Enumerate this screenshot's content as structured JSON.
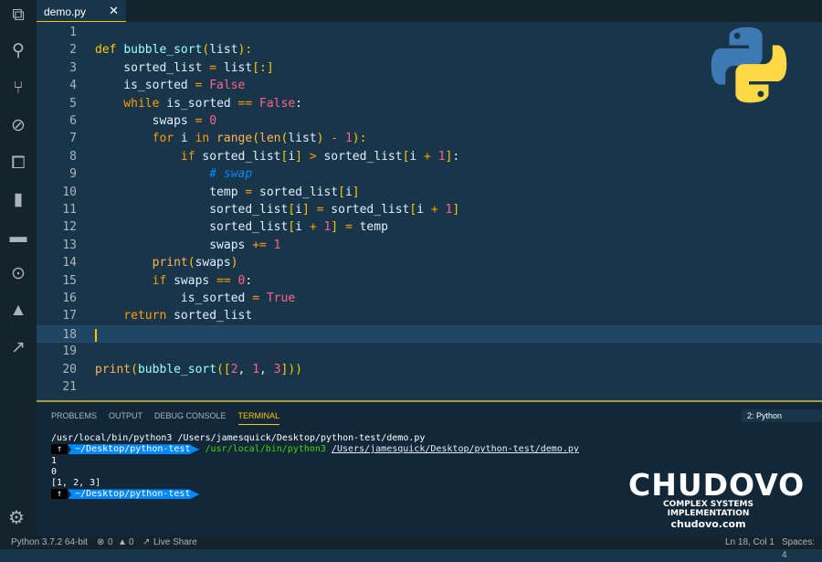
{
  "tab": {
    "label": "demo.py",
    "close": "✕"
  },
  "activity_icons": [
    "files-icon",
    "search-icon",
    "source-control-icon",
    "debug-icon",
    "extensions-icon",
    "bookmark-icon",
    "folder-icon",
    "git-lens-icon",
    "firebase-icon",
    "live-share-icon"
  ],
  "colors": {
    "editor_bg": "#193549",
    "keyword": "#ffc600",
    "string_bool": "#ff628c",
    "operator": "#ff9d00",
    "comment": "#0088ff"
  },
  "code_lines": [
    [],
    [
      [
        "kw",
        "def "
      ],
      [
        "fn",
        "bubble_sort"
      ],
      [
        "pu",
        "("
      ],
      [
        "id",
        "list"
      ],
      [
        "pu",
        "):"
      ]
    ],
    [
      [
        "id",
        "    sorted_list "
      ],
      [
        "op",
        "="
      ],
      [
        "id",
        " list"
      ],
      [
        "pu",
        "[:]"
      ]
    ],
    [
      [
        "id",
        "    is_sorted "
      ],
      [
        "op",
        "="
      ],
      [
        "bo",
        " False"
      ]
    ],
    [
      [
        "kw2",
        "    while"
      ],
      [
        "id",
        " is_sorted "
      ],
      [
        "op",
        "=="
      ],
      [
        "bo",
        " False"
      ],
      [
        "id",
        ":"
      ]
    ],
    [
      [
        "id",
        "        swaps "
      ],
      [
        "op",
        "="
      ],
      [
        "nu",
        " 0"
      ]
    ],
    [
      [
        "kw2",
        "        for"
      ],
      [
        "id",
        " i "
      ],
      [
        "kw2",
        "in"
      ],
      [
        "bi",
        " range"
      ],
      [
        "pu",
        "("
      ],
      [
        "bi",
        "len"
      ],
      [
        "pu",
        "("
      ],
      [
        "id",
        "list"
      ],
      [
        "pu",
        ")"
      ],
      [
        "op",
        " -"
      ],
      [
        "nu",
        " 1"
      ],
      [
        "pu",
        "):"
      ]
    ],
    [
      [
        "kw2",
        "            if"
      ],
      [
        "id",
        " sorted_list"
      ],
      [
        "pu",
        "["
      ],
      [
        "id",
        "i"
      ],
      [
        "pu",
        "]"
      ],
      [
        "op",
        " >"
      ],
      [
        "id",
        " sorted_list"
      ],
      [
        "pu",
        "["
      ],
      [
        "id",
        "i "
      ],
      [
        "op",
        "+"
      ],
      [
        "nu",
        " 1"
      ],
      [
        "pu",
        "]"
      ],
      [
        "id",
        ":"
      ]
    ],
    [
      [
        "cm",
        "                # swap"
      ]
    ],
    [
      [
        "id",
        "                temp "
      ],
      [
        "op",
        "="
      ],
      [
        "id",
        " sorted_list"
      ],
      [
        "pu",
        "["
      ],
      [
        "id",
        "i"
      ],
      [
        "pu",
        "]"
      ]
    ],
    [
      [
        "id",
        "                sorted_list"
      ],
      [
        "pu",
        "["
      ],
      [
        "id",
        "i"
      ],
      [
        "pu",
        "]"
      ],
      [
        "op",
        " ="
      ],
      [
        "id",
        " sorted_list"
      ],
      [
        "pu",
        "["
      ],
      [
        "id",
        "i "
      ],
      [
        "op",
        "+"
      ],
      [
        "nu",
        " 1"
      ],
      [
        "pu",
        "]"
      ]
    ],
    [
      [
        "id",
        "                sorted_list"
      ],
      [
        "pu",
        "["
      ],
      [
        "id",
        "i "
      ],
      [
        "op",
        "+"
      ],
      [
        "nu",
        " 1"
      ],
      [
        "pu",
        "]"
      ],
      [
        "op",
        " ="
      ],
      [
        "id",
        " temp"
      ]
    ],
    [
      [
        "id",
        "                swaps "
      ],
      [
        "op",
        "+="
      ],
      [
        "nu",
        " 1"
      ]
    ],
    [
      [
        "bi",
        "        print"
      ],
      [
        "pu",
        "("
      ],
      [
        "id",
        "swaps"
      ],
      [
        "pu",
        ")"
      ]
    ],
    [
      [
        "kw2",
        "        if"
      ],
      [
        "id",
        " swaps "
      ],
      [
        "op",
        "=="
      ],
      [
        "nu",
        " 0"
      ],
      [
        "id",
        ":"
      ]
    ],
    [
      [
        "id",
        "            is_sorted "
      ],
      [
        "op",
        "="
      ],
      [
        "bo",
        " True"
      ]
    ],
    [
      [
        "kw2",
        "    return"
      ],
      [
        "id",
        " sorted_list"
      ]
    ],
    [],
    [],
    [
      [
        "bi",
        "print"
      ],
      [
        "pu",
        "("
      ],
      [
        "fn",
        "bubble_sort"
      ],
      [
        "pu",
        "(["
      ],
      [
        "nu",
        "2"
      ],
      [
        "id",
        ", "
      ],
      [
        "nu",
        "1"
      ],
      [
        "id",
        ", "
      ],
      [
        "nu",
        "3"
      ],
      [
        "pu",
        "]))"
      ]
    ],
    []
  ],
  "current_line": 18,
  "panel": {
    "tabs": [
      "PROBLEMS",
      "OUTPUT",
      "DEBUG CONSOLE",
      "TERMINAL"
    ],
    "active_tab": "TERMINAL",
    "terminal_select": "2: Python"
  },
  "terminal": {
    "line1": "/usr/local/bin/python3 /Users/jamesquick/Desktop/python-test/demo.py",
    "arrow": "↑",
    "dir": "~/Desktop/python-test",
    "cmd": "/usr/local/bin/python3",
    "file": "/Users/jamesquick/Desktop/python-test/demo.py",
    "out1": "1",
    "out2": "0",
    "out3": "[1, 2, 3]"
  },
  "brand": {
    "name": "CHUDOVO",
    "tagline": "COMPLEX SYSTEMS IMPLEMENTATION",
    "site": "chudovo.com"
  },
  "status": {
    "python": "Python 3.7.2 64-bit",
    "errors": "0",
    "warnings": "0",
    "live_share": "Live Share",
    "position": "Ln 18, Col 1",
    "spaces": "Spaces: 4"
  }
}
